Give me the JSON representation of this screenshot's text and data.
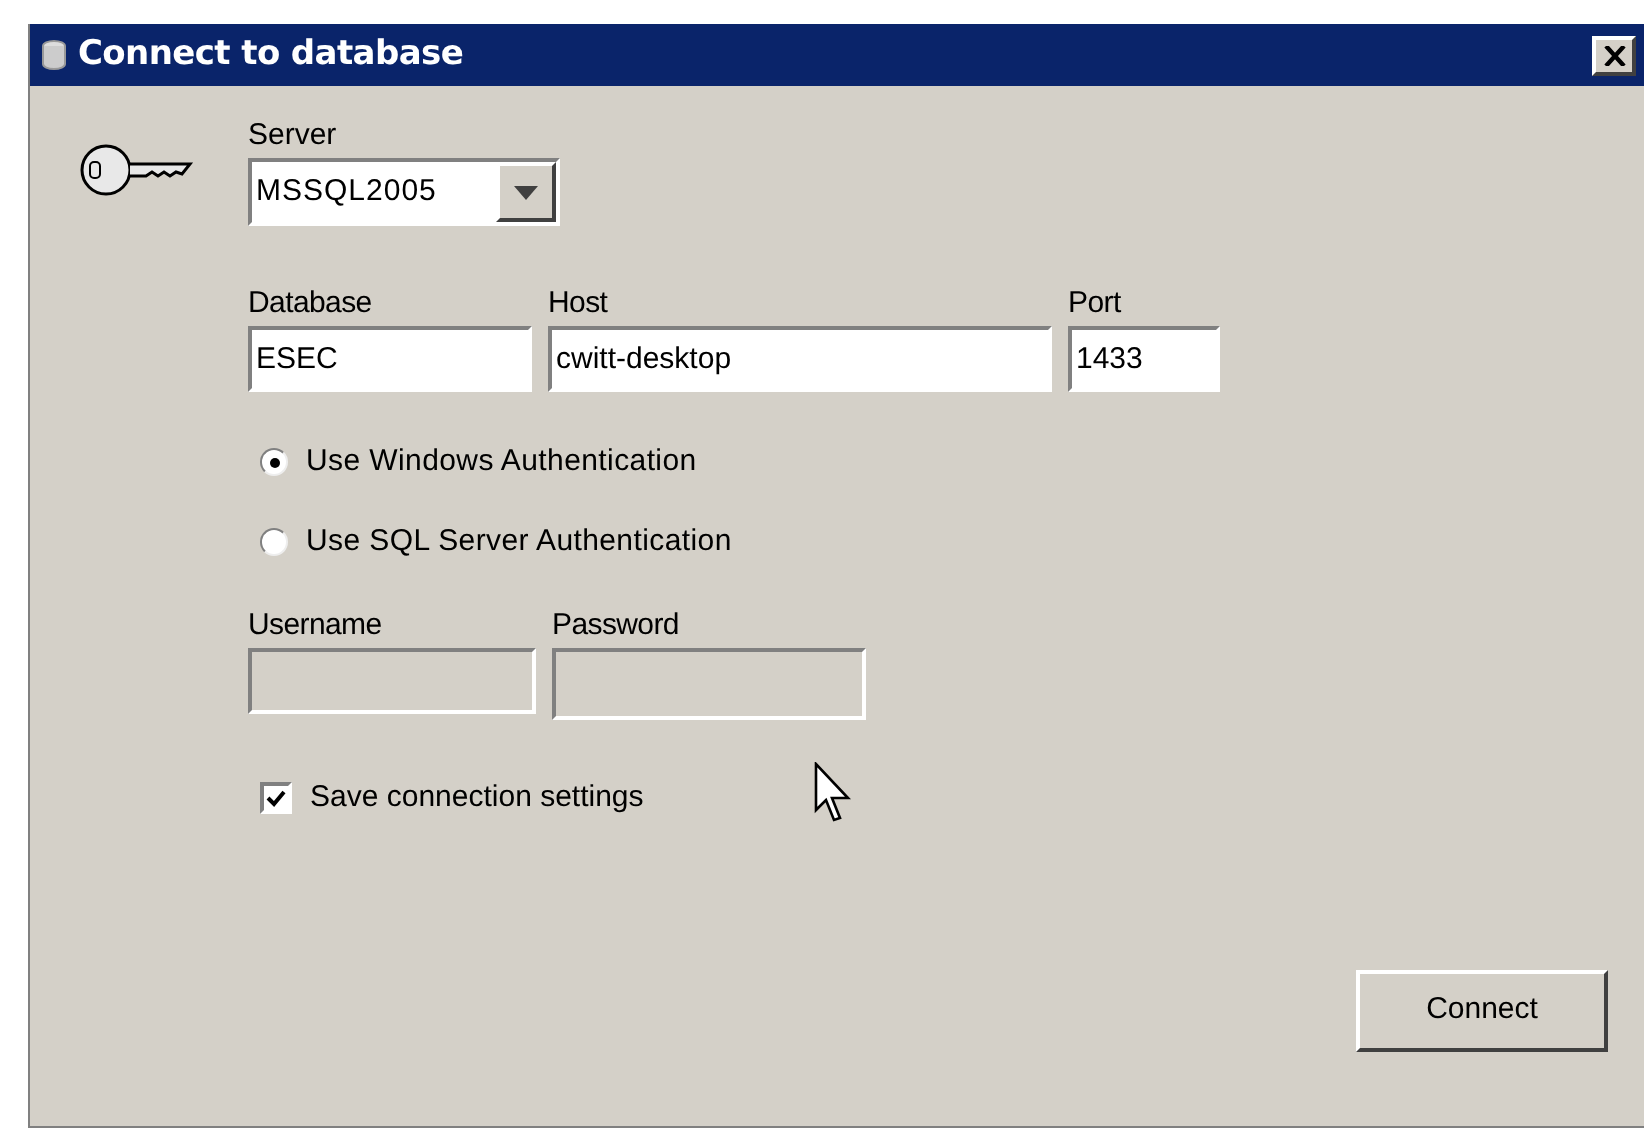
{
  "window": {
    "title": "Connect to database"
  },
  "server": {
    "label": "Server",
    "value": "MSSQL2005"
  },
  "location_fields": [
    {
      "label": "Database",
      "value": "ESEC",
      "disabled": false
    },
    {
      "label": "Host",
      "value": "cwitt-desktop",
      "disabled": false
    },
    {
      "label": "Port",
      "value": "1433",
      "disabled": false
    }
  ],
  "auth_options": [
    {
      "label": "Use Windows Authentication",
      "selected": true
    },
    {
      "label": "Use SQL Server Authentication",
      "selected": false
    }
  ],
  "credential_fields": [
    {
      "label": "Username",
      "disabled": true
    },
    {
      "label": "Password",
      "disabled": true
    }
  ],
  "save_settings": {
    "label": "Save connection settings",
    "checked": true
  },
  "connect_button": {
    "label": "Connect"
  }
}
